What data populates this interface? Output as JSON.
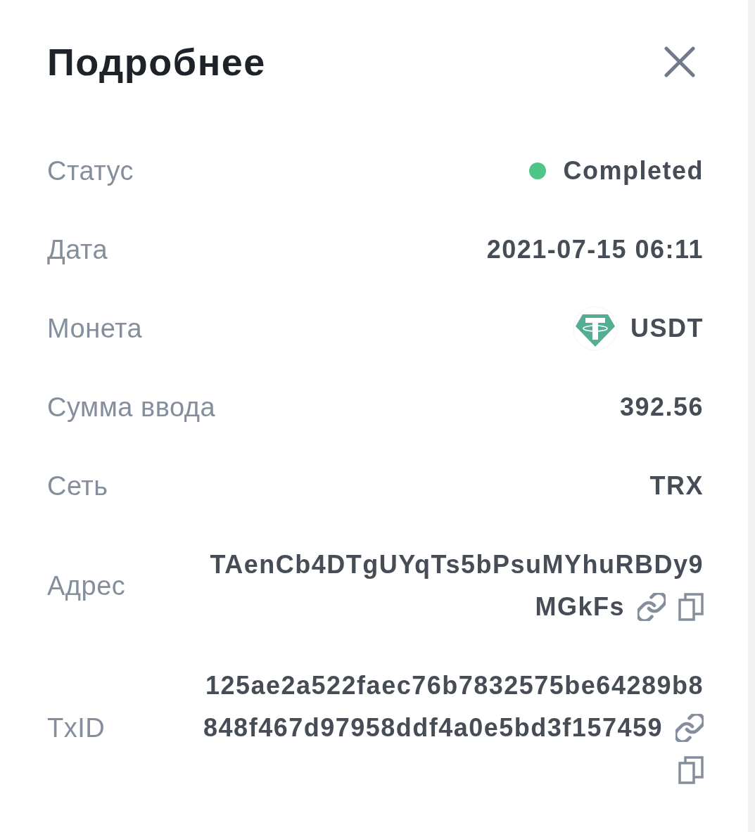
{
  "dialog": {
    "title": "Подробнее"
  },
  "rows": [
    {
      "kind": "status",
      "label": "Статус",
      "value": "Completed",
      "color": "#4fc686"
    },
    {
      "kind": "text",
      "label": "Дата",
      "value": "2021-07-15 06:11"
    },
    {
      "kind": "coin",
      "label": "Монета",
      "value": "USDT"
    },
    {
      "kind": "text",
      "label": "Сумма ввода",
      "value": "392.56"
    },
    {
      "kind": "text",
      "label": "Сеть",
      "value": "TRX"
    },
    {
      "kind": "hash",
      "label": "Адрес",
      "lines": [
        "TAenCb4DTgUYqTs5bPsuMYhuRBDy9",
        "MGkFs"
      ]
    },
    {
      "kind": "hash",
      "label": "TxID",
      "lines": [
        "125ae2a522faec76b7832575be64289b8",
        "848f467d97958ddf4a0e5bd3f157459"
      ]
    }
  ]
}
